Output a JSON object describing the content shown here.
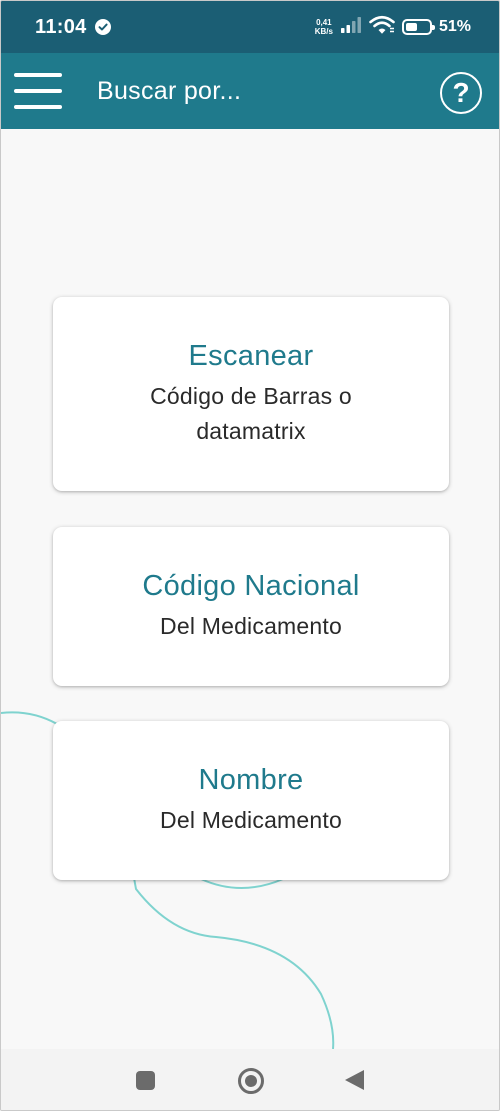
{
  "status_bar": {
    "time": "11:04",
    "net_speed_value": "0,41",
    "net_speed_unit": "KB/s",
    "battery_percent": "51%",
    "battery_level": 0.51
  },
  "app_bar": {
    "title": "Buscar por...",
    "help_label": "?"
  },
  "cards": [
    {
      "title": "Escanear",
      "subtitle": "Código de Barras o datamatrix"
    },
    {
      "title": "Código Nacional",
      "subtitle": "Del Medicamento"
    },
    {
      "title": "Nombre",
      "subtitle": "Del Medicamento"
    }
  ],
  "colors": {
    "status_bar": "#1b5e74",
    "app_bar": "#1f7a8c",
    "accent_text": "#1f7a8c",
    "decor_curve": "#7fd3cf",
    "background": "#f8f8f8"
  }
}
